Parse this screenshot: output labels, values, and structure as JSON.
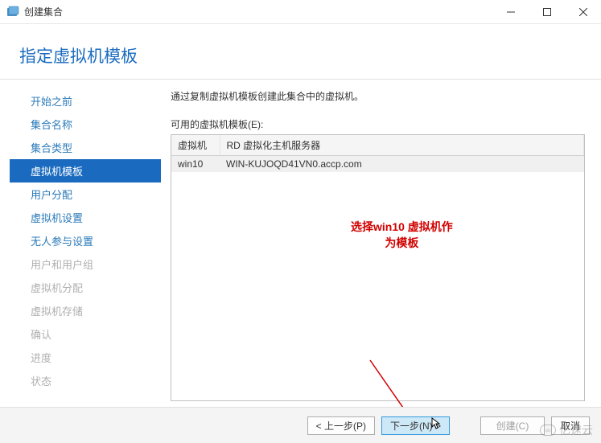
{
  "window": {
    "title": "创建集合"
  },
  "page": {
    "title": "指定虚拟机模板"
  },
  "sidebar": {
    "items": [
      {
        "label": "开始之前",
        "state": "normal"
      },
      {
        "label": "集合名称",
        "state": "normal"
      },
      {
        "label": "集合类型",
        "state": "normal"
      },
      {
        "label": "虚拟机模板",
        "state": "selected"
      },
      {
        "label": "用户分配",
        "state": "normal"
      },
      {
        "label": "虚拟机设置",
        "state": "normal"
      },
      {
        "label": "无人参与设置",
        "state": "normal"
      },
      {
        "label": "用户和用户组",
        "state": "disabled"
      },
      {
        "label": "虚拟机分配",
        "state": "disabled"
      },
      {
        "label": "虚拟机存储",
        "state": "disabled"
      },
      {
        "label": "确认",
        "state": "disabled"
      },
      {
        "label": "进度",
        "state": "disabled"
      },
      {
        "label": "状态",
        "state": "disabled"
      }
    ]
  },
  "main": {
    "instruction": "通过复制虚拟机模板创建此集合中的虚拟机。",
    "list_label": "可用的虚拟机模板(E):",
    "columns": {
      "vm": "虚拟机",
      "host": "RD 虚拟化主机服务器"
    },
    "rows": [
      {
        "vm": "win10",
        "host": "WIN-KUJOQD41VN0.accp.com"
      }
    ],
    "annotation_line1": "选择win10 虚拟机作",
    "annotation_line2": "为模板"
  },
  "footer": {
    "prev": "< 上一步(P)",
    "next": "下一步(N) >",
    "create": "创建(C)",
    "cancel": "取消"
  },
  "watermark": {
    "text": "亿速云"
  }
}
